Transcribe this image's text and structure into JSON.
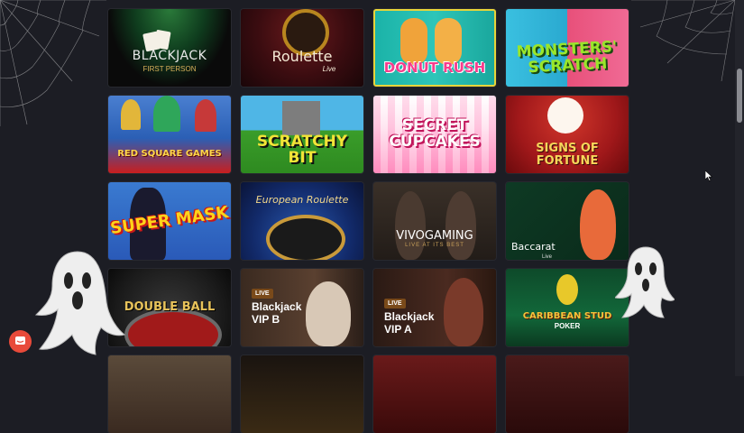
{
  "games": [
    {
      "id": "blackjack-first-person",
      "title": "BLACKJACK",
      "subtitle": "FIRST PERSON"
    },
    {
      "id": "roulette-live",
      "title": "Roulette",
      "subtitle": "Live"
    },
    {
      "id": "donut-rush",
      "title": "DONUT RUSH"
    },
    {
      "id": "monsters-scratch",
      "title": "MONSTERS' SCRATCH"
    },
    {
      "id": "red-square-games",
      "title": "RED SQUARE GAMES"
    },
    {
      "id": "scratchy-bit",
      "title": "SCRATCHY BIT"
    },
    {
      "id": "secret-cupcakes",
      "title": "SECRET CUPCAKES"
    },
    {
      "id": "signs-of-fortune",
      "title": "SIGNS OF FORTUNE"
    },
    {
      "id": "super-mask",
      "title": "SUPER MASK"
    },
    {
      "id": "european-roulette",
      "title": "European Roulette"
    },
    {
      "id": "vivo-gaming",
      "title": "VIVOGAMING",
      "subtitle": "LIVE AT ITS BEST"
    },
    {
      "id": "baccarat-live",
      "title": "Baccarat",
      "subtitle": "Live"
    },
    {
      "id": "double-ball",
      "title": "DOUBLE BALL"
    },
    {
      "id": "blackjack-vip-b",
      "badge": "LIVE",
      "title": "Blackjack",
      "subtitle": "VIP B"
    },
    {
      "id": "blackjack-vip-a",
      "badge": "LIVE",
      "title": "Blackjack",
      "subtitle": "VIP A"
    },
    {
      "id": "caribbean-stud",
      "title": "CARIBBEAN STUD",
      "subtitle": "POKER"
    }
  ],
  "colors": {
    "background": "#1c1d24",
    "accent": "#e84a3a"
  },
  "icons": {
    "chat": "chat-bubble-icon",
    "cursor": "mouse-pointer-icon",
    "ghost": "ghost-icon",
    "cobweb": "cobweb-icon"
  }
}
